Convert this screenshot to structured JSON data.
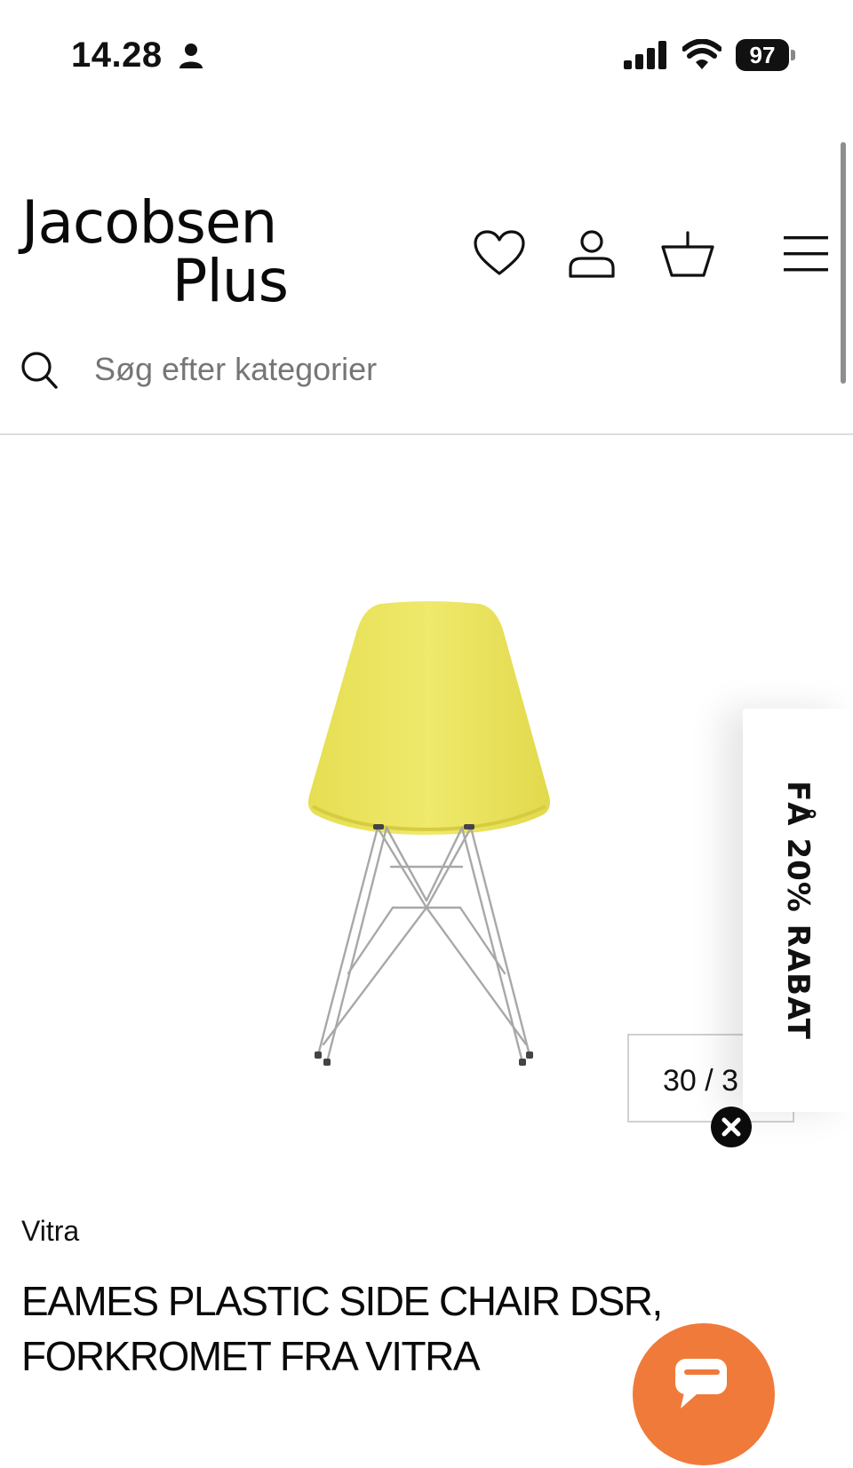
{
  "status_bar": {
    "time": "14.28",
    "battery": "97"
  },
  "header": {
    "logo_line1": "Jacobsen",
    "logo_line2": "Plus",
    "icons": [
      "heart-icon",
      "user-icon",
      "basket-icon",
      "menu-icon"
    ]
  },
  "search": {
    "placeholder": "Søg efter kategorier"
  },
  "gallery": {
    "counter": "30 / 3",
    "image": "yellow-plastic-side-chair-chrome-eiffel-base"
  },
  "promo": {
    "label": "FÅ 20% RABAT"
  },
  "product": {
    "brand": "Vitra",
    "title_line1": "EAMES PLASTIC SIDE CHAIR DSR,",
    "title_line2": "FORKROMET FRA VITRA"
  },
  "colors": {
    "accent": "#f07a3a",
    "chair_yellow": "#ece55c",
    "text": "#111111"
  }
}
